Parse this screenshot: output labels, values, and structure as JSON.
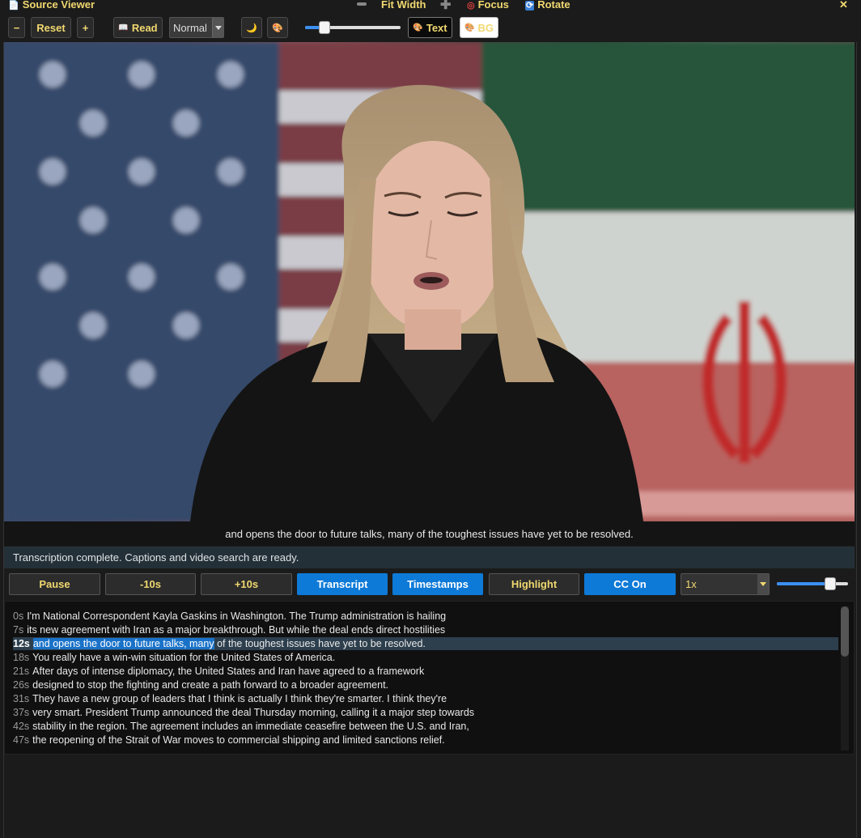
{
  "window": {
    "title": "Source Viewer",
    "title_icon": "document-icon",
    "fit_width": "Fit Width",
    "focus": "Focus",
    "rotate": "Rotate",
    "close": "✕"
  },
  "toolbar": {
    "minus": "−",
    "reset": "Reset",
    "plus": "+",
    "read": "Read",
    "mode_value": "Normal",
    "moon": "🌙",
    "palette": "🎨",
    "zoom_level": 0.2,
    "text": "Text",
    "bg": "BG"
  },
  "video": {
    "caption": "and opens the door to future talks, many of the toughest issues have yet to be resolved."
  },
  "status": "Transcription complete. Captions and video search are ready.",
  "controls": {
    "pause": "Pause",
    "back": "-10s",
    "forward": "+10s",
    "transcript": "Transcript",
    "timestamps": "Timestamps",
    "highlight": "Highlight",
    "cc": "CC On",
    "speed": "1x",
    "volume": 0.75
  },
  "transcript": [
    {
      "t": "0s",
      "text": "I'm National Correspondent Kayla Gaskins in Washington. The Trump administration is hailing"
    },
    {
      "t": "7s",
      "text": "its new agreement with Iran as a major breakthrough. But while the deal ends direct hostilities"
    },
    {
      "t": "12s",
      "hl": "and opens the door to future talks, many",
      "text": " of the toughest issues have yet to be resolved."
    },
    {
      "t": "18s",
      "text": "You really have a win-win situation for the United States of America."
    },
    {
      "t": "21s",
      "text": "After days of intense diplomacy, the United States and Iran have agreed to a framework"
    },
    {
      "t": "26s",
      "text": "designed to stop the fighting and create a path forward to a broader agreement."
    },
    {
      "t": "31s",
      "text": "They have a new group of leaders that I think is actually I think they're smarter. I think they're"
    },
    {
      "t": "37s",
      "text": "very smart. President Trump announced the deal Thursday morning, calling it a major step towards"
    },
    {
      "t": "42s",
      "text": "stability in the region. The agreement includes an immediate ceasefire between the U.S. and Iran,"
    },
    {
      "t": "47s",
      "text": "the reopening of the Strait of War moves to commercial shipping and limited sanctions relief."
    }
  ],
  "colors": {
    "accent": "#f0d870",
    "blue": "#0e7ad8",
    "highlight": "#1a72c8"
  }
}
